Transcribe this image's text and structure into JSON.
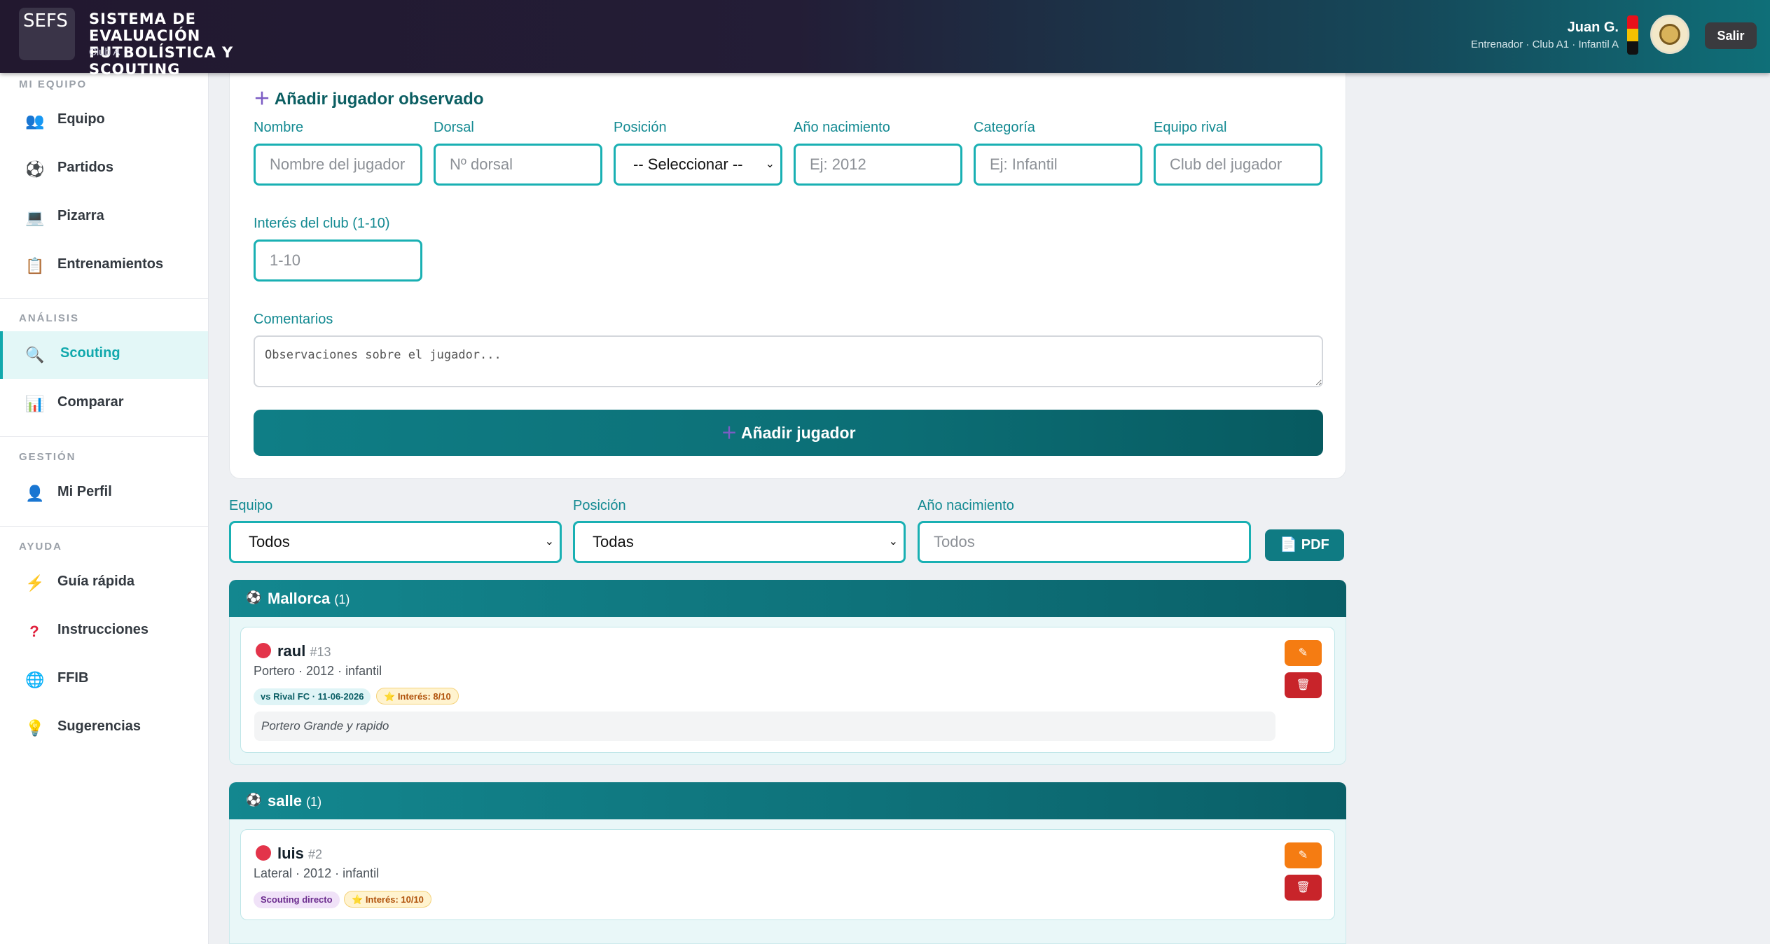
{
  "header": {
    "logo_alt": "SEFS",
    "title": "SISTEMA DE EVALUACIÓN FUTBOLÍSTICA Y SCOUTING",
    "club": "Club A",
    "user_name": "Juan G.",
    "user_role": "Entrenador · Club A1 · Infantil A",
    "logout_label": "Salir",
    "flag_colors": [
      "#e8101a",
      "#f5c000",
      "#111111"
    ]
  },
  "sidebar": {
    "sections": [
      {
        "title": "MI EQUIPO",
        "items": [
          {
            "label": "Equipo",
            "icon": "players-icon"
          },
          {
            "label": "Partidos",
            "icon": "soccer-ball-icon"
          },
          {
            "label": "Pizarra",
            "icon": "laptop-icon"
          },
          {
            "label": "Entrenamientos",
            "icon": "clipboard-icon"
          }
        ]
      },
      {
        "title": "ANÁLISIS",
        "items": [
          {
            "label": "Scouting",
            "icon": "magnifier-icon",
            "active": true
          },
          {
            "label": "Comparar",
            "icon": "bar-chart-icon"
          }
        ]
      },
      {
        "title": "GESTIÓN",
        "items": [
          {
            "label": "Mi Perfil",
            "icon": "user-icon"
          }
        ]
      },
      {
        "title": "AYUDA",
        "items": [
          {
            "label": "Guía rápida",
            "icon": "lightning-icon"
          },
          {
            "label": "Instrucciones",
            "icon": "question-icon"
          },
          {
            "label": "FFIB",
            "icon": "globe-icon"
          },
          {
            "label": "Sugerencias",
            "icon": "lightbulb-icon"
          }
        ]
      }
    ]
  },
  "form": {
    "title": "Añadir jugador observado",
    "fields": {
      "nombre": {
        "label": "Nombre",
        "placeholder": "Nombre del jugador"
      },
      "dorsal": {
        "label": "Dorsal",
        "placeholder": "Nº dorsal"
      },
      "posicion": {
        "label": "Posición",
        "value": "-- Seleccionar --"
      },
      "anio": {
        "label": "Año nacimiento",
        "placeholder": "Ej: 2012"
      },
      "categoria": {
        "label": "Categoría",
        "placeholder": "Ej: Infantil"
      },
      "rival": {
        "label": "Equipo rival",
        "placeholder": "Club del jugador"
      },
      "interes": {
        "label": "Interés del club (1-10)",
        "placeholder": "1-10"
      },
      "comentarios": {
        "label": "Comentarios",
        "placeholder": "Observaciones sobre el jugador..."
      }
    },
    "submit_label": "Añadir jugador"
  },
  "filters": {
    "equipo": {
      "label": "Equipo",
      "value": "Todos"
    },
    "posicion": {
      "label": "Posición",
      "value": "Todas"
    },
    "anio": {
      "label": "Año nacimiento",
      "placeholder": "Todos"
    },
    "pdf_label": "PDF"
  },
  "groups": [
    {
      "name": "Mallorca",
      "count": "(1)",
      "player": {
        "name": "raul",
        "number": "#13",
        "meta": "Portero · 2012 · infantil",
        "tag": "vs Rival FC · 11-06-2026",
        "interest": "Interés: 8/10",
        "note": "Portero Grande y rapido"
      }
    },
    {
      "name": "salle",
      "count": "(1)",
      "player": {
        "name": "luis",
        "number": "#2",
        "meta": "Lateral · 2012 · infantil",
        "tag": "Scouting directo",
        "interest": "Interés: 10/10"
      }
    }
  ]
}
